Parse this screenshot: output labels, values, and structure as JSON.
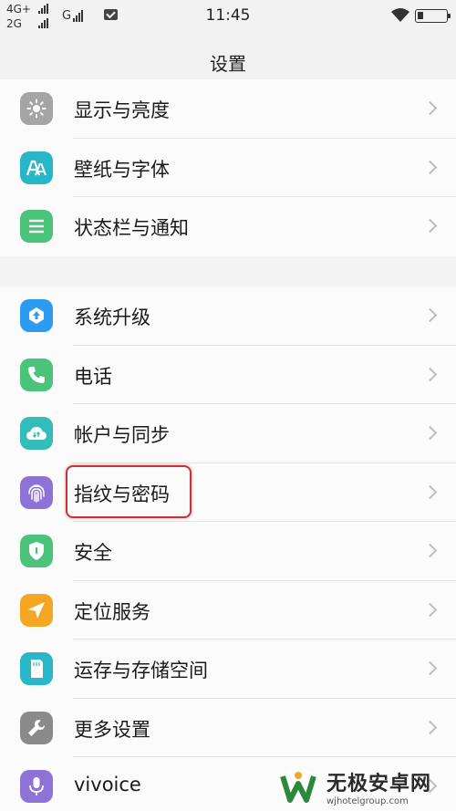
{
  "status_bar": {
    "network_line1": "4G+",
    "network_line2": "2G",
    "carrier": "G",
    "time": "11:45"
  },
  "header": {
    "title": "设置"
  },
  "groups": [
    {
      "items": [
        {
          "label": "显示与亮度",
          "icon": "brightness-icon",
          "color": "#9e9e9e"
        },
        {
          "label": "壁纸与字体",
          "icon": "font-icon",
          "color": "#29b6c9"
        },
        {
          "label": "状态栏与通知",
          "icon": "list-icon",
          "color": "#4cc37b"
        }
      ]
    },
    {
      "items": [
        {
          "label": "系统升级",
          "icon": "upgrade-icon",
          "color": "#2d9cf0"
        },
        {
          "label": "电话",
          "icon": "phone-icon",
          "color": "#4cc37b"
        },
        {
          "label": "帐户与同步",
          "icon": "cloud-icon",
          "color": "#34bcb8"
        },
        {
          "label": "指纹与密码",
          "icon": "fingerprint-icon",
          "color": "#8e72d6"
        },
        {
          "label": "安全",
          "icon": "shield-icon",
          "color": "#4cc37b"
        },
        {
          "label": "定位服务",
          "icon": "location-icon",
          "color": "#f5a623"
        },
        {
          "label": "运存与存储空间",
          "icon": "storage-icon",
          "color": "#29b6c9"
        },
        {
          "label": "更多设置",
          "icon": "wrench-icon",
          "color": "#8a8a8a"
        },
        {
          "label": "vivoice",
          "icon": "microphone-icon",
          "color": "#8e72d6"
        }
      ]
    }
  ],
  "watermark": {
    "title": "无极安卓网",
    "url": "wjhotelgroup.com"
  }
}
